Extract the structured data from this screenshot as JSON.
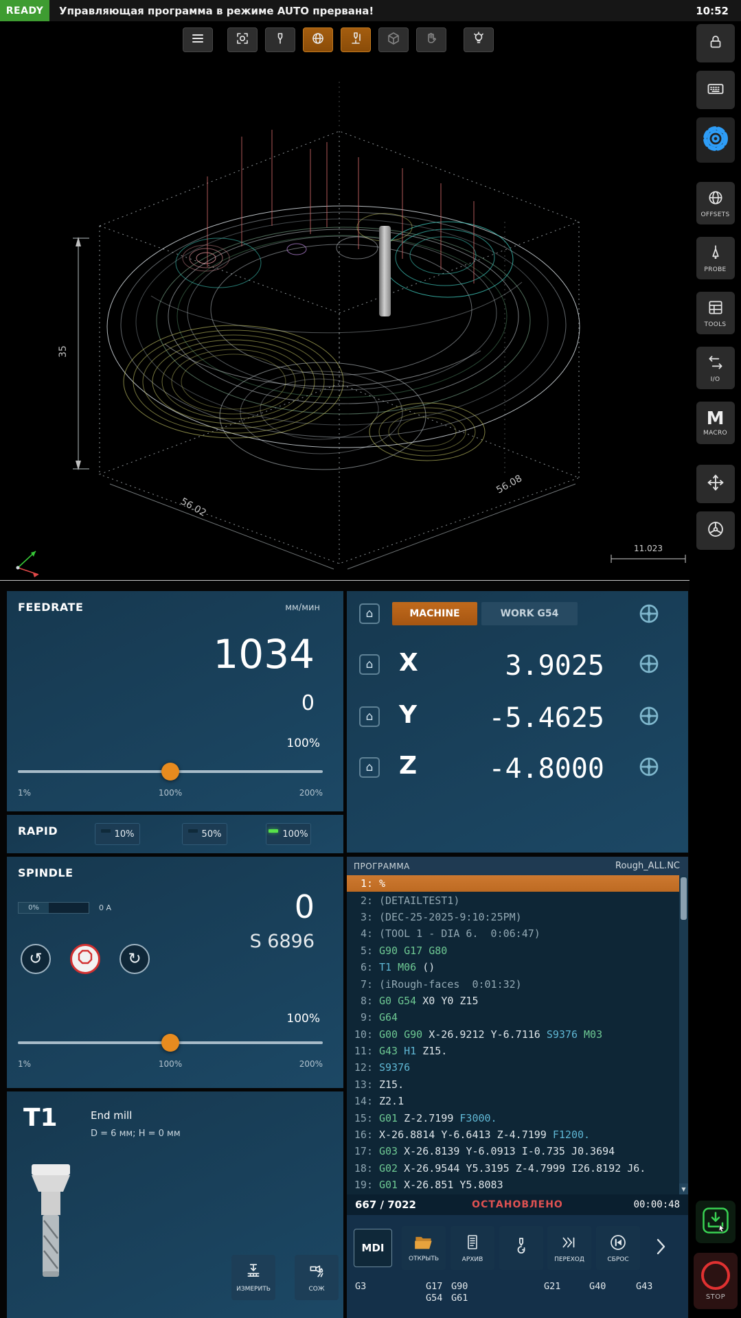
{
  "colors": {
    "accent_orange": "#e78b1f",
    "ready_green": "#3e9c31",
    "stop_red": "#e03131",
    "active_line_orange": "#c8722a",
    "settings_blue": "#2e9df7",
    "status_red": "#e05252",
    "led_green": "#58e34a"
  },
  "topbar": {
    "ready": "READY",
    "message": "Управляющая программа в режиме AUTO прервана!",
    "time": "10:52"
  },
  "viewer": {
    "toolbar": [
      "menu-icon",
      "fit-view-icon",
      "tool-probe-icon",
      "globe-icon",
      "tool-measure-icon",
      "cube-icon",
      "pan-hand-icon",
      "lamp-icon"
    ],
    "dimensions": {
      "width_left": "56.02",
      "width_right": "56.08",
      "height": "35",
      "scale": "11.023"
    }
  },
  "feedrate": {
    "title": "FEEDRATE",
    "units": "мм/мин",
    "actual": "1034",
    "secondary": "0",
    "override": "100%",
    "scale_min": "1%",
    "scale_mid": "100%",
    "scale_max": "200%"
  },
  "rapid": {
    "title": "RAPID",
    "options": [
      {
        "label": "10%",
        "active": false
      },
      {
        "label": "50%",
        "active": false
      },
      {
        "label": "100%",
        "active": true
      }
    ]
  },
  "spindle": {
    "title": "SPINDLE",
    "load": "0%",
    "current": "0 A",
    "actual": "0",
    "programmed": "S 6896",
    "override": "100%",
    "scale_min": "1%",
    "scale_mid": "100%",
    "scale_max": "200%"
  },
  "tool": {
    "id": "T1",
    "type": "End mill",
    "description": "D = 6 мм; H = 0 мм",
    "measure_label": "ИЗМЕРИТЬ",
    "coolant_label": "СОЖ"
  },
  "position": {
    "tabs": [
      {
        "label": "MACHINE",
        "active": true
      },
      {
        "label": "WORK G54",
        "active": false
      }
    ],
    "axes": [
      {
        "name": "X",
        "value": "3.9025"
      },
      {
        "name": "Y",
        "value": "-5.4625"
      },
      {
        "name": "Z",
        "value": "-4.8000"
      }
    ]
  },
  "program": {
    "title": "ПРОГРАММА",
    "file": "Rough_ALL.NC",
    "active_line": 0,
    "lines": [
      {
        "n": "1",
        "text": "%"
      },
      {
        "n": "2",
        "text": "(DETAILTEST1)"
      },
      {
        "n": "3",
        "text": "(DEC-25-2025-9:10:25PM)"
      },
      {
        "n": "4",
        "text": "(TOOL 1 - DIA 6.  0:06:47)"
      },
      {
        "n": "5",
        "text": "G90 G17 G80"
      },
      {
        "n": "6",
        "text": "T1 M06 ()"
      },
      {
        "n": "7",
        "text": "(iRough-faces  0:01:32)"
      },
      {
        "n": "8",
        "text": "G0 G54 X0 Y0 Z15"
      },
      {
        "n": "9",
        "text": "G64"
      },
      {
        "n": "10",
        "text": "G00 G90 X-26.9212 Y-6.7116 S9376 M03"
      },
      {
        "n": "11",
        "text": "G43 H1 Z15."
      },
      {
        "n": "12",
        "text": "S9376"
      },
      {
        "n": "13",
        "text": "Z15."
      },
      {
        "n": "14",
        "text": "Z2.1"
      },
      {
        "n": "15",
        "text": "G01 Z-2.7199 F3000."
      },
      {
        "n": "16",
        "text": "X-26.8814 Y-6.6413 Z-4.7199 F1200."
      },
      {
        "n": "17",
        "text": "G03 X-26.8139 Y-6.0913 I-0.735 J0.3694"
      },
      {
        "n": "18",
        "text": "G02 X-26.9544 Y5.3195 Z-4.7999 I26.8192 J6."
      },
      {
        "n": "19",
        "text": "G01 X-26.851 Y5.8083"
      }
    ],
    "progress": "667 / 7022",
    "state": "ОСТАНОВЛЕНО",
    "elapsed": "00:00:48",
    "buttons": [
      {
        "name": "mdi",
        "label": "MDI"
      },
      {
        "name": "open",
        "label": "ОТКРЫТЬ"
      },
      {
        "name": "archive",
        "label": "АРХИВ"
      },
      {
        "name": "tool-change",
        "label": ""
      },
      {
        "name": "goto",
        "label": "ПЕРЕХОД"
      },
      {
        "name": "reset",
        "label": "СБРОС"
      }
    ],
    "gcodes": [
      [
        "G3"
      ],
      [
        "G17",
        "G54"
      ],
      [
        "G90",
        "G61"
      ],
      [
        "G21"
      ],
      [
        "G40"
      ],
      [
        "G43"
      ]
    ]
  },
  "sidebar": {
    "items": [
      {
        "name": "lock",
        "label": ""
      },
      {
        "name": "keyboard",
        "label": ""
      },
      {
        "name": "settings",
        "label": ""
      },
      {
        "name": "offsets",
        "label": "OFFSETS"
      },
      {
        "name": "probe",
        "label": "PROBE"
      },
      {
        "name": "tools",
        "label": "TOOLS"
      },
      {
        "name": "io",
        "label": "I/O"
      },
      {
        "name": "macro",
        "label": "MACRO"
      },
      {
        "name": "jog",
        "label": ""
      },
      {
        "name": "handwheel",
        "label": ""
      }
    ],
    "stop_label": "STOP"
  }
}
